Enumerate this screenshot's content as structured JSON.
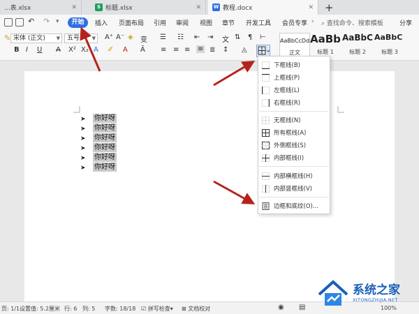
{
  "tabs": [
    {
      "label": "...表.xlsx",
      "icon": "spreadsheet-icon",
      "color": "#1f9d55"
    },
    {
      "label": "标题.xlsx",
      "icon": "spreadsheet-icon",
      "color": "#1f9d55"
    },
    {
      "label": "教程.docx",
      "icon": "writer-doc-icon",
      "color": "#2e6fe3"
    }
  ],
  "menu": {
    "start": "开始",
    "items": [
      "插入",
      "页面布局",
      "引用",
      "审阅",
      "视图",
      "章节",
      "开发工具",
      "会员专享"
    ],
    "search": "查找命令、搜索模板",
    "share": "分享"
  },
  "ribbon": {
    "font_name": "宋体 (正文)",
    "font_size": "五号",
    "styles": [
      {
        "preview": "AaBbCcDd",
        "label": "正文"
      },
      {
        "preview": "AaBb",
        "label": "标题 1"
      },
      {
        "preview": "AaBbC",
        "label": "标题 2"
      },
      {
        "preview": "AaBbC",
        "label": "标题 3"
      }
    ]
  },
  "document": {
    "lines": [
      "你好呀",
      "你好呀",
      "你好呀",
      "你好呀",
      "你好呀",
      "你好呀"
    ],
    "bullet": "➤"
  },
  "border_menu": {
    "items": [
      {
        "label": "下框线(B)",
        "icon": "border-bottom-icon"
      },
      {
        "label": "上框线(P)",
        "icon": "border-top-icon"
      },
      {
        "label": "左框线(L)",
        "icon": "border-left-icon"
      },
      {
        "label": "右框线(R)",
        "icon": "border-right-icon"
      },
      {
        "label": "无框线(N)",
        "icon": "border-none-icon"
      },
      {
        "label": "所有框线(A)",
        "icon": "border-all-icon"
      },
      {
        "label": "外侧框线(S)",
        "icon": "border-outside-icon"
      },
      {
        "label": "内部框线(I)",
        "icon": "border-inside-icon"
      },
      {
        "label": "内部横框线(H)",
        "icon": "border-inside-horizontal-icon"
      },
      {
        "label": "内部竖框线(V)",
        "icon": "border-inside-vertical-icon"
      },
      {
        "label": "边框和底纹(O)...",
        "icon": "borders-shading-icon"
      }
    ]
  },
  "status": {
    "page": "页: 1/1",
    "setting": "设置值: 5.2厘米",
    "row": "行: 6",
    "col": "列: 5",
    "words": "字数: 18/18",
    "spell": "拼写检查",
    "proof": "文档校对",
    "zoom": "100%"
  },
  "watermark": {
    "title": "系统之家",
    "url": "XITONGZHIJIA.NET"
  },
  "colors": {
    "accent": "#2e6fe3",
    "arrow": "#b5221b"
  }
}
